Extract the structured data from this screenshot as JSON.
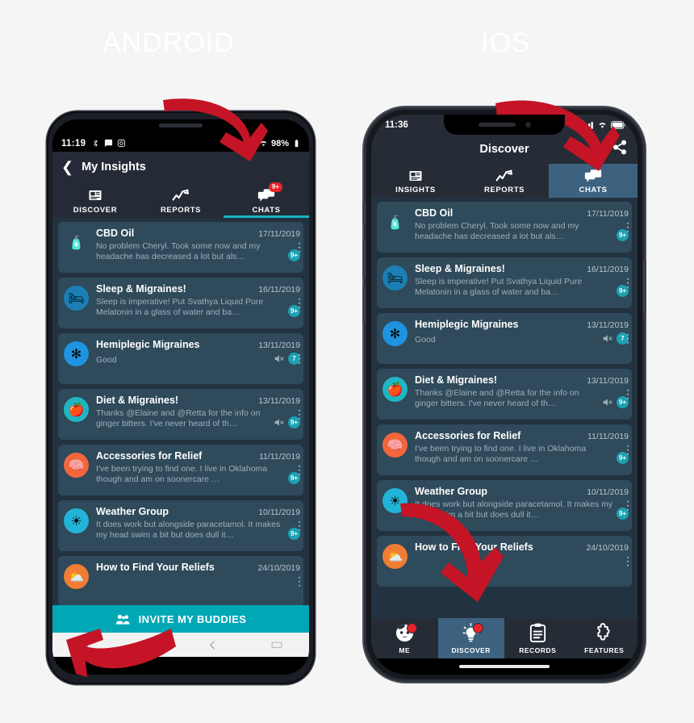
{
  "page": {
    "background": "#f5f5f5",
    "accent_teal": "#00a7b5",
    "badge_red": "#e8232a",
    "card_bg": "#2f4a5a",
    "screen_bg": "#233240",
    "bar_bg": "#262c36"
  },
  "headings": {
    "android": "ANDROID",
    "ios": "IOS"
  },
  "android": {
    "status": {
      "time": "11:19",
      "battery": "98%",
      "icons": [
        "bluetooth-icon",
        "message-icon",
        "instagram-icon",
        "vibrate-icon",
        "wifi-icon",
        "battery-icon"
      ]
    },
    "appbar": {
      "back_icon": "chevron-left-icon",
      "title": "My Insights"
    },
    "tabs": [
      {
        "label": "DISCOVER",
        "icon": "news-icon",
        "active": false,
        "badge": ""
      },
      {
        "label": "REPORTS",
        "icon": "chart-line-icon",
        "active": false,
        "badge": ""
      },
      {
        "label": "CHATS",
        "icon": "chat-bubbles-icon",
        "active": true,
        "badge": "9+"
      }
    ],
    "invite_button": {
      "label": "INVITE MY BUDDIES",
      "icon": "people-group-icon"
    },
    "navbar": [
      "recents-icon",
      "home-icon",
      "back-icon",
      "keyboard-icon"
    ]
  },
  "ios": {
    "status": {
      "time": "11:36",
      "icons": [
        "signal-icon",
        "wifi-icon",
        "battery-icon"
      ]
    },
    "appbar": {
      "title": "Discover",
      "share_icon": "share-icon"
    },
    "tabs": [
      {
        "label": "INSIGHTS",
        "icon": "news-icon",
        "active": false
      },
      {
        "label": "REPORTS",
        "icon": "chart-line-icon",
        "active": false
      },
      {
        "label": "CHATS",
        "icon": "chat-bubbles-icon",
        "active": true
      }
    ],
    "bottom_tabs": [
      {
        "label": "ME",
        "icon": "person-face-icon",
        "active": false,
        "dot": true
      },
      {
        "label": "DISCOVER",
        "icon": "lightbulb-icon",
        "active": true,
        "dot": true
      },
      {
        "label": "RECORDS",
        "icon": "clipboard-icon",
        "active": false,
        "dot": false
      },
      {
        "label": "FEATURES",
        "icon": "puzzle-piece-icon",
        "active": false,
        "dot": false
      }
    ]
  },
  "chats": [
    {
      "title": "CBD Oil",
      "date": "17/11/2019",
      "preview": "No problem Cheryl. Took some now and my headache has decreased a lot but als…",
      "badge": "9+",
      "muted": false,
      "avatar_icon": "cbd-bottles-icon",
      "avatar_bg": "transparent",
      "avatar_glyph": "🧴"
    },
    {
      "title": "Sleep & Migraines!",
      "date": "16/11/2019",
      "preview": "Sleep is imperative! Put Svathya Liquid Pure Melatonin in a glass of water and ba…",
      "badge": "9+",
      "muted": false,
      "avatar_icon": "pillow-sleep-icon",
      "avatar_bg": "#1b7fb5",
      "avatar_glyph": "🛏"
    },
    {
      "title": "Hemiplegic Migraines",
      "date": "13/11/2019",
      "preview": "Good",
      "badge": "7",
      "muted": true,
      "avatar_icon": "medical-star-icon",
      "avatar_bg": "#1e93e0",
      "avatar_glyph": "✻"
    },
    {
      "title": "Diet & Migraines!",
      "date": "13/11/2019",
      "preview": "Thanks @Elaine and @Retta for the info on ginger bitters. I've never heard of th…",
      "badge": "9+",
      "muted": true,
      "avatar_icon": "apple-health-icon",
      "avatar_bg": "#1fb6c4",
      "avatar_glyph": "🍎"
    },
    {
      "title": "Accessories for Relief",
      "date": "11/11/2019",
      "preview": "I've been trying to find one.  I live in Oklahoma though and am on soonercare …",
      "badge": "9+",
      "muted": false,
      "avatar_icon": "head-nerves-icon",
      "avatar_bg": "#f2663c",
      "avatar_glyph": "🧠"
    },
    {
      "title": "Weather Group",
      "date": "10/11/2019",
      "preview": "It does work but alongside paracetamol. It makes my head swim a bit but does dull it…",
      "badge": "9+",
      "muted": false,
      "avatar_icon": "sun-icon",
      "avatar_bg": "#22b4d8",
      "avatar_glyph": "☀"
    },
    {
      "title": "How to Find Your Reliefs",
      "date": "24/10/2019",
      "preview": "",
      "badge": "",
      "muted": false,
      "avatar_icon": "sun-cloud-icon",
      "avatar_bg": "#f07d33",
      "avatar_glyph": "⛅"
    }
  ],
  "annotations": {
    "arrow_color": "#c41425",
    "arrows": [
      {
        "name": "arrow-to-android-chats-tab"
      },
      {
        "name": "arrow-to-android-invite-button"
      },
      {
        "name": "arrow-to-ios-share-button"
      },
      {
        "name": "arrow-to-ios-discover-tab"
      }
    ]
  }
}
